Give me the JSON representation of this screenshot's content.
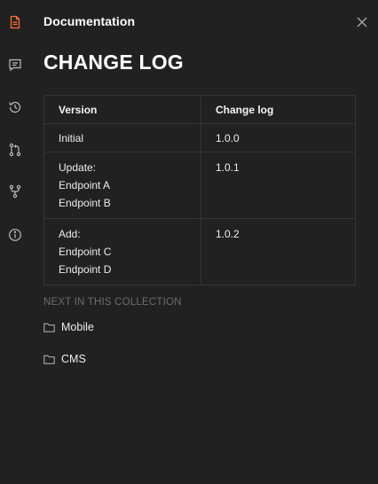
{
  "header": {
    "title": "Documentation"
  },
  "page": {
    "title": "CHANGE LOG"
  },
  "table": {
    "headers": [
      "Version",
      "Change log"
    ],
    "rows": [
      {
        "version_lines": [
          "Initial"
        ],
        "changelog": "1.0.0"
      },
      {
        "version_lines": [
          "Update:",
          "Endpoint A",
          "Endpoint B"
        ],
        "changelog": "1.0.1"
      },
      {
        "version_lines": [
          "Add:",
          "Endpoint C",
          "Endpoint D"
        ],
        "changelog": "1.0.2"
      }
    ]
  },
  "next": {
    "heading": "NEXT IN THIS COLLECTION",
    "items": [
      {
        "icon": "folder-icon",
        "label": "Mobile"
      },
      {
        "icon": "folder-icon",
        "label": "CMS"
      }
    ]
  },
  "rail": {
    "icons": [
      "documentation-icon",
      "comments-icon",
      "history-icon",
      "pull-request-icon",
      "fork-icon",
      "info-icon"
    ]
  },
  "colors": {
    "background": "#212121",
    "accent": "#ff6c37",
    "border": "#353535",
    "muted_text": "#6c6c6c"
  }
}
